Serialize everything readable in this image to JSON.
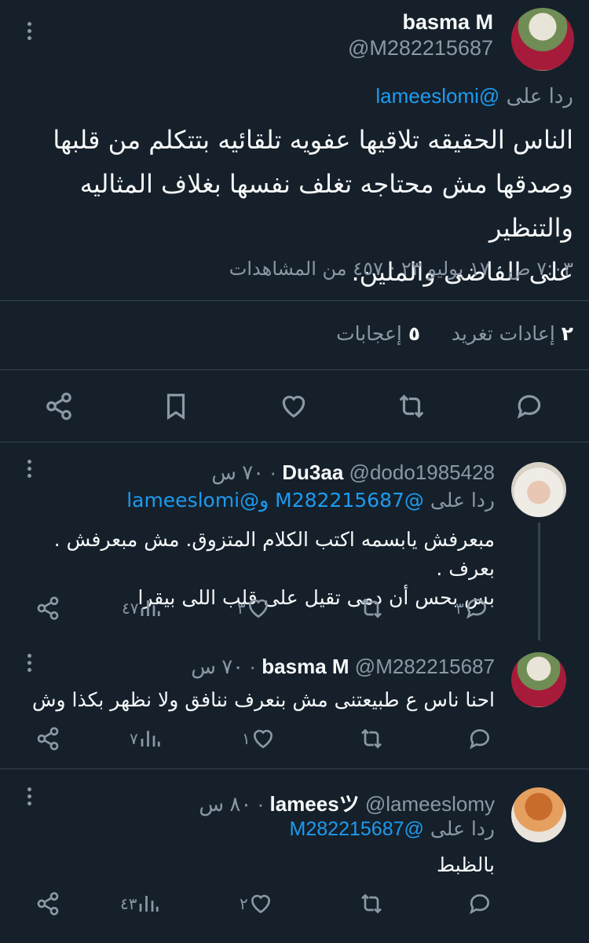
{
  "main_tweet": {
    "name": "basma M",
    "handle": "@M282215687",
    "reply_prefix": "ردا على",
    "reply_to": "@lameeslomi",
    "text_lines": [
      "الناس الحقيقه تلاقيها عفويه تلقائيه بتتكلم من قلبها",
      "وصدقها مش محتاجه تغلف نفسها بغلاف المثاليه والتنظير",
      "على الفاضى والملين."
    ],
    "meta": "٧:٠٣ ص · ١٧ يوليو ٢٣ · ٤٥٧ من المشاهدات",
    "stats": {
      "retweets_count": "٢",
      "retweets_label": "إعادات تغريد",
      "likes_count": "٥",
      "likes_label": "إعجابات"
    }
  },
  "replies": [
    {
      "name": "Du3aa",
      "handle": "@dodo1985428",
      "time": "٧٠ س",
      "reply_prefix": "ردا على",
      "reply_to": "@M282215687 و@lameeslomi",
      "text_lines": [
        "مبعرفش يابسمه اكتب الكلام المتزوق. مش مبعرفش . بعرف .",
        "بس بحس أن دمى تقيل على قلب اللى بيقرا"
      ],
      "views": "٤٧",
      "likes": "٣",
      "retweets": "",
      "comments": "٣"
    },
    {
      "name": "basma M",
      "handle": "@M282215687",
      "time": "٧٠ س",
      "text_lines": [
        "احنا ناس ع طبيعتنى مش بنعرف ننافق ولا نظهر بكذا وش"
      ],
      "views": "٧",
      "likes": "١",
      "retweets": "",
      "comments": ""
    },
    {
      "name": "lameesツ",
      "handle": "@lameeslomy",
      "time": "٨٠ س",
      "reply_prefix": "ردا على",
      "reply_to": "@M282215687",
      "text_lines": [
        "بالظبط"
      ],
      "views": "٤٣",
      "likes": "٢",
      "retweets": "",
      "comments": ""
    }
  ],
  "colors": {
    "background": "#15202b",
    "text": "#f7f9f9",
    "secondary": "#8b98a5",
    "link": "#1d9bf0",
    "divider": "#38444d"
  },
  "icons": [
    "more-icon",
    "share-icon",
    "bookmark-icon",
    "heart-icon",
    "retweet-icon",
    "comment-icon",
    "views-icon"
  ]
}
